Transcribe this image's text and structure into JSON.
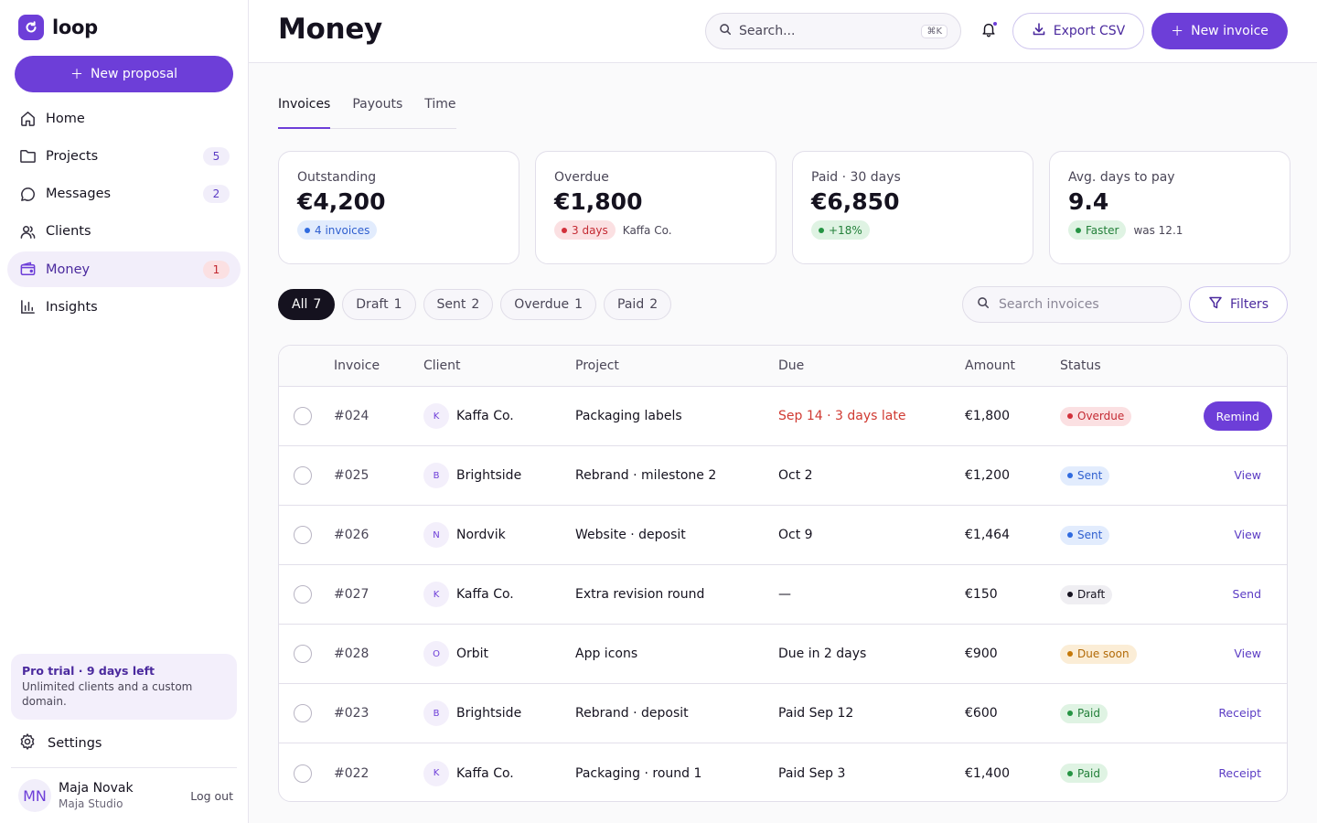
{
  "app": {
    "name": "loop",
    "new_proposal": "New proposal"
  },
  "nav": [
    {
      "label": "Home",
      "icon": "home-icon",
      "count": ""
    },
    {
      "label": "Projects",
      "icon": "folder-icon",
      "count": "5"
    },
    {
      "label": "Messages",
      "icon": "chat-icon",
      "count": "2"
    },
    {
      "label": "Clients",
      "icon": "users-icon",
      "count": ""
    },
    {
      "label": "Money",
      "icon": "wallet-icon",
      "count": "1",
      "active": true
    },
    {
      "label": "Insights",
      "icon": "chart-icon",
      "count": ""
    }
  ],
  "trial": {
    "title": "Pro trial · 9 days left",
    "text": "Unlimited clients and a custom domain."
  },
  "settings": "Settings",
  "user": {
    "initials": "MN",
    "name": "Maja Novak",
    "org": "Maja Studio",
    "logout": "Log out"
  },
  "header": {
    "title": "Money",
    "search_placeholder": "Search...",
    "search_shortcut": "⌘K",
    "export": "Export CSV",
    "new_invoice": "New invoice"
  },
  "tabs": [
    {
      "label": "Invoices",
      "active": true
    },
    {
      "label": "Payouts"
    },
    {
      "label": "Time"
    }
  ],
  "stats": [
    {
      "label": "Outstanding",
      "value": "€4,200",
      "chip": "4 invoices",
      "chip_color": "blue",
      "note": ""
    },
    {
      "label": "Overdue",
      "value": "€1,800",
      "chip": "3 days",
      "chip_color": "red",
      "note": "Kaffa Co."
    },
    {
      "label": "Paid · 30 days",
      "value": "€6,850",
      "chip": "+18%",
      "chip_color": "green",
      "note": ""
    },
    {
      "label": "Avg. days to pay",
      "value": "9.4",
      "chip": "Faster",
      "chip_color": "green",
      "note": "was 12.1"
    }
  ],
  "filters": [
    {
      "label": "All",
      "count": "7",
      "active": true
    },
    {
      "label": "Draft",
      "count": "1"
    },
    {
      "label": "Sent",
      "count": "2"
    },
    {
      "label": "Overdue",
      "count": "1"
    },
    {
      "label": "Paid",
      "count": "2"
    }
  ],
  "invoice_search_placeholder": "Search invoices",
  "filters_button": "Filters",
  "table": {
    "columns": {
      "invoice": "Invoice",
      "client": "Client",
      "project": "Project",
      "due": "Due",
      "amount": "Amount",
      "status": "Status"
    },
    "rows": [
      {
        "invoice": "#024",
        "initial": "K",
        "client": "Kaffa Co.",
        "project": "Packaging labels",
        "due": "Sep 14 · 3 days late",
        "due_late": true,
        "amount": "€1,800",
        "status": "Overdue",
        "status_color": "red",
        "action": "Remind",
        "action_primary": true
      },
      {
        "invoice": "#025",
        "initial": "B",
        "client": "Brightside",
        "project": "Rebrand · milestone 2",
        "due": "Oct 2",
        "amount": "€1,200",
        "status": "Sent",
        "status_color": "blue",
        "action": "View"
      },
      {
        "invoice": "#026",
        "initial": "N",
        "client": "Nordvik",
        "project": "Website · deposit",
        "due": "Oct 9",
        "amount": "€1,464",
        "status": "Sent",
        "status_color": "blue",
        "action": "View"
      },
      {
        "invoice": "#027",
        "initial": "K",
        "client": "Kaffa Co.",
        "project": "Extra revision round",
        "due": "—",
        "amount": "€150",
        "status": "Draft",
        "status_color": "gray",
        "action": "Send"
      },
      {
        "invoice": "#028",
        "initial": "O",
        "client": "Orbit",
        "project": "App icons",
        "due": "Due in 2 days",
        "amount": "€900",
        "status": "Due soon",
        "status_color": "amber",
        "action": "View"
      },
      {
        "invoice": "#023",
        "initial": "B",
        "client": "Brightside",
        "project": "Rebrand · deposit",
        "due": "Paid Sep 12",
        "amount": "€600",
        "status": "Paid",
        "status_color": "green",
        "action": "Receipt"
      },
      {
        "invoice": "#022",
        "initial": "K",
        "client": "Kaffa Co.",
        "project": "Packaging · round 1",
        "due": "Paid Sep 3",
        "amount": "€1,400",
        "status": "Paid",
        "status_color": "green",
        "action": "Receipt"
      }
    ]
  },
  "colors": {
    "accent": "#6d3ed8",
    "overdue": "#d03a32"
  }
}
